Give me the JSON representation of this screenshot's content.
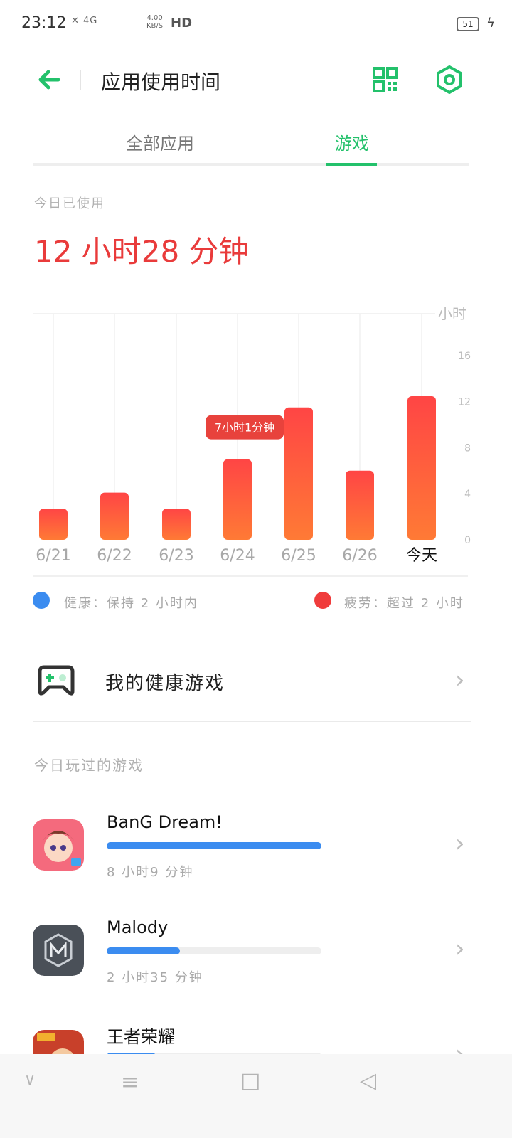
{
  "status": {
    "time": "23:12",
    "signal": "✕ 4G",
    "speed_value": "4.00",
    "speed_unit": "KB/S",
    "hd": "HD",
    "battery": "51"
  },
  "header": {
    "title": "应用使用时间"
  },
  "tabs": [
    {
      "label": "全部应用",
      "active": false
    },
    {
      "label": "游戏",
      "active": true
    }
  ],
  "summary": {
    "label": "今日已使用",
    "value": "12 小时28 分钟"
  },
  "chart_data": {
    "type": "bar",
    "ylabel": "小时",
    "yticks": [
      "16",
      "12",
      "8",
      "4",
      "0"
    ],
    "ylim": [
      0,
      20
    ],
    "categories": [
      "6/21",
      "6/22",
      "6/23",
      "6/24",
      "6/25",
      "6/26",
      "今天"
    ],
    "values": [
      2.7,
      4.1,
      2.7,
      7.0,
      11.5,
      6.0,
      12.47
    ],
    "tooltip": {
      "category": "6/24",
      "text": "7小时1分钟"
    },
    "color_top": "#ff4545",
    "color_bottom": "#ff7a35"
  },
  "legend": {
    "healthy": "健康：保持 2 小时内",
    "tired": "疲劳：超过 2 小时",
    "healthy_color": "#3b8cf0",
    "tired_color": "#f03c3c"
  },
  "health_games": {
    "label": "我的健康游戏",
    "icon": "gamepad-icon"
  },
  "played": {
    "label": "今日玩过的游戏",
    "games": [
      {
        "name": "BanG Dream!",
        "time": "8 小时9 分钟",
        "progress": 1.0,
        "icon": "bang-dream-app-icon"
      },
      {
        "name": "Malody",
        "time": "2 小时35 分钟",
        "progress": 0.34,
        "icon": "malody-app-icon"
      },
      {
        "name": "王者荣耀",
        "time": "",
        "progress": 0.23,
        "icon": "honor-of-kings-app-icon"
      }
    ]
  },
  "nav": {
    "down": "∨",
    "menu": "≡",
    "home": "□",
    "back": "◁"
  }
}
